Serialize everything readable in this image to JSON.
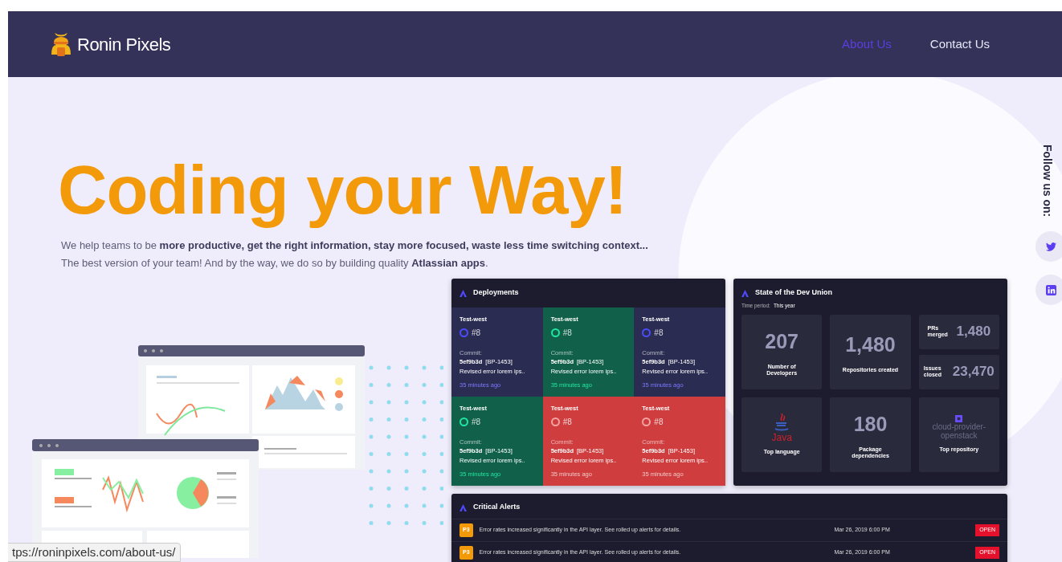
{
  "nav": {
    "brand": "Ronin Pixels",
    "links": [
      {
        "label": "About Us",
        "selected": true
      },
      {
        "label": "Contact Us",
        "selected": false
      }
    ]
  },
  "hero": {
    "title": "Coding your Way!",
    "lines": [
      "We help teams to be **more productive, get the right information, stay more focused, waste less time switching context...**",
      "The best version of your team! And by the way, we do so by building quality **Atlassian apps**."
    ]
  },
  "social": {
    "label": "Follow us on:",
    "links": [
      {
        "kind": "twitter"
      },
      {
        "kind": "linkedin"
      }
    ]
  },
  "deployments": {
    "title": "Deployments",
    "tiles": [
      {
        "kind": "pending",
        "name": "Test-west",
        "build": "#8",
        "commit_label": "Commit:",
        "hash": "5ef9b3d",
        "ref": "[BP-1453]",
        "message": "Revised error lorem ips..",
        "time": "35 minutes ago"
      },
      {
        "kind": "success",
        "name": "Test-west",
        "build": "#8",
        "commit_label": "Commit:",
        "hash": "5ef9b3d",
        "ref": "[BP-1453]",
        "message": "Revised error lorem ips..",
        "time": "35 minutes ago"
      },
      {
        "kind": "pending",
        "name": "Test-west",
        "build": "#8",
        "commit_label": "Commit:",
        "hash": "5ef9b3d",
        "ref": "[BP-1453]",
        "message": "Revised error lorem ips..",
        "time": "35 minutes ago"
      },
      {
        "kind": "success",
        "name": "Test-west",
        "build": "#8",
        "commit_label": "Commit:",
        "hash": "5ef9b3d",
        "ref": "[BP-1453]",
        "message": "Revised error lorem ips..",
        "time": "35 minutes ago"
      },
      {
        "kind": "failed",
        "name": "Test-west",
        "build": "#8",
        "commit_label": "Commit:",
        "hash": "5ef9b3d",
        "ref": "[BP-1453]",
        "message": "Revised error lorem ips..",
        "time": "35 minutes ago"
      },
      {
        "kind": "failed",
        "name": "Test-west",
        "build": "#8",
        "commit_label": "Commit:",
        "hash": "5ef9b3d",
        "ref": "[BP-1453]",
        "message": "Revised error lorem ips..",
        "time": "35 minutes ago"
      }
    ]
  },
  "dev_union": {
    "title": "State of the Dev Union",
    "period_label": "Time period:",
    "period": "This year",
    "tiles": [
      {
        "kind": "big",
        "value": "207",
        "label": "Number of Developers"
      },
      {
        "kind": "big",
        "value": "1,480",
        "label": "Repositories created"
      },
      {
        "kind": "pair",
        "items": [
          {
            "label": "PRs merged",
            "value": "1,480"
          },
          {
            "label": "Issues closed",
            "value": "23,470"
          }
        ]
      },
      {
        "kind": "language",
        "value": "Java",
        "label": "Top language"
      },
      {
        "kind": "big",
        "value": "180",
        "label": "Package dependencies"
      },
      {
        "kind": "repo",
        "value": "cloud-provider-openstack",
        "label": "Top repository"
      }
    ]
  },
  "alerts": {
    "title": "Critical Alerts",
    "rows": [
      {
        "priority": "P3",
        "message": "Error rates increased significantly in the API layer. See rolled up alerts for details.",
        "date": "Mar 26, 2019 6:00 PM",
        "status": "OPEN"
      },
      {
        "priority": "P3",
        "message": "Error rates increased significantly in the API layer. See rolled up alerts for details.",
        "date": "Mar 26, 2019 6:00 PM",
        "status": "OPEN"
      }
    ]
  },
  "status_url": "tps://roninpixels.com/about-us/"
}
